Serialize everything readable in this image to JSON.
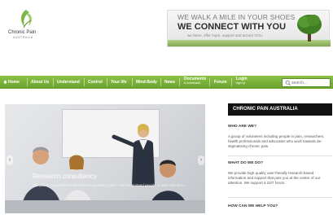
{
  "logo": {
    "name": "Chronic Pain",
    "sub": "AUSTRALIA",
    "color": "#7ab648"
  },
  "banner": {
    "line1": "WE WALK A MILE IN YOUR SHOES",
    "line2": "WE CONNECT WITH YOU",
    "line3": "we listen, offer hope, support and accept YOU."
  },
  "nav": {
    "items": [
      {
        "label": "Home",
        "icon": "home-icon"
      },
      {
        "label": "About Us"
      },
      {
        "label": "Understand"
      },
      {
        "label": "Control"
      },
      {
        "label": "Your life"
      },
      {
        "label": "Mind-Body"
      },
      {
        "label": "News"
      },
      {
        "label": "Documents",
        "sub": "& downloads"
      },
      {
        "label": "Forum"
      },
      {
        "label": "Login",
        "sub": "sign up"
      }
    ],
    "search_placeholder": "search...",
    "bar_color": "#7ab648"
  },
  "slide": {
    "title": "Research consultancy",
    "text": "Are you an organisation interested in people in pain? We understand people in pain. Ask us to..."
  },
  "sidebar": {
    "title": "CHRONIC PAIN AUSTRALIA",
    "sections": [
      {
        "heading": "WHO ARE WE?",
        "text": "A group of volunteers including people in pain, researchers, health professionals and advocates who work towards de-stigmatising chronic pain."
      },
      {
        "heading": "WHAT DO WE DO?",
        "text": "We provide high quality user-friendly research-based information and support that puts you at the centre of our attention. We support a 24/7 forum."
      },
      {
        "heading": "HOW CAN WE HELP YOU?",
        "text": ""
      }
    ]
  }
}
